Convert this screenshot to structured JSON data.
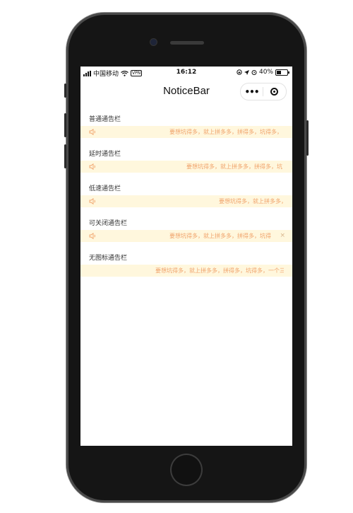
{
  "status_bar": {
    "carrier": "中国移动",
    "vpn": "VPN",
    "time": "16:12",
    "battery": "40%"
  },
  "nav": {
    "title": "NoticeBar",
    "more_icon": "•••",
    "close_icon": "circle-target-icon"
  },
  "sections": [
    {
      "title": "普通通告栏",
      "text": "要想坑得多，就上拼多多，拼得多，坑得多，"
    },
    {
      "title": "延时通告栏",
      "text": "要想坑得多，就上拼多多，拼得多，坑"
    },
    {
      "title": "低速通告栏",
      "text": "要想坑得多，就上拼多多，"
    },
    {
      "title": "可关闭通告栏",
      "text": "要想坑得多，就上拼多多，拼得多，坑得",
      "close": "×"
    },
    {
      "title": "无图标通告栏",
      "text": "要想坑得多，就上拼多多，拼得多，坑得多，一个三"
    }
  ],
  "colors": {
    "bar_bg": "#fff7dd",
    "bar_text": "#f0a26a",
    "icon": "#f0a26a"
  }
}
